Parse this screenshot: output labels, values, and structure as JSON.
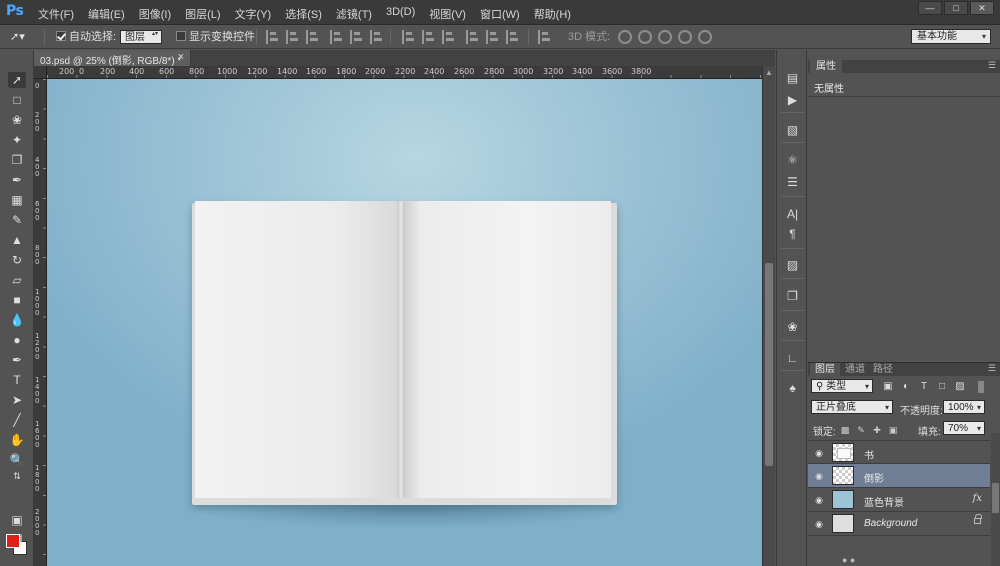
{
  "app": {
    "logo": "Ps",
    "menus": [
      "文件(F)",
      "编辑(E)",
      "图像(I)",
      "图层(L)",
      "文字(Y)",
      "选择(S)",
      "滤镜(T)",
      "3D(D)",
      "视图(V)",
      "窗口(W)",
      "帮助(H)"
    ],
    "window_controls": [
      "minimize",
      "restore",
      "close"
    ]
  },
  "options_bar": {
    "auto_select_label": "自动选择:",
    "auto_select_checked": true,
    "auto_select_value": "图层",
    "show_transform_label": "显示变换控件",
    "show_transform_checked": false,
    "mode_3d_label": "3D 模式:",
    "workspace": "基本功能"
  },
  "document": {
    "tab_title": "03.psd @ 25% (倒影, RGB/8*) *",
    "close_glyph": "×"
  },
  "rulers": {
    "horizontal": [
      "200",
      "0",
      "200",
      "400",
      "600",
      "800",
      "1000",
      "1200",
      "1400",
      "1600",
      "1800",
      "2000",
      "2200",
      "2400",
      "2600",
      "2800",
      "3000",
      "3200",
      "3400",
      "3600",
      "3800"
    ],
    "vertical": [
      "0",
      "200",
      "400",
      "600",
      "800",
      "1000",
      "1200",
      "1400",
      "1600",
      "1800",
      "2000"
    ]
  },
  "canvas": {
    "background_color": "#9ec4d6",
    "subject": "open blank book"
  },
  "colors": {
    "foreground": "#e31c1c",
    "background": "#ffffff",
    "selection": "#6f7e95"
  },
  "tools": [
    "move-tool",
    "marquee-tool",
    "lasso-tool",
    "magic-wand-tool",
    "eyedropper-tool",
    "healing-brush-tool",
    "brush-tool",
    "clone-stamp-tool",
    "history-brush-tool",
    "eraser-tool",
    "gradient-tool",
    "blur-tool",
    "dodge-tool",
    "pen-tool",
    "type-tool",
    "path-selection-tool",
    "line-tool",
    "hand-tool",
    "zoom-tool"
  ],
  "properties_panel": {
    "tab": "属性",
    "empty_text": "无属性"
  },
  "layers_panel": {
    "tabs": [
      "图层",
      "通道",
      "路径"
    ],
    "filter_kind": "类型",
    "blend_mode": "正片叠底",
    "opacity_label": "不透明度:",
    "opacity_value": "100%",
    "lock_label": "锁定:",
    "fill_label": "填充:",
    "fill_value": "70%",
    "layers": [
      {
        "name": "书",
        "selected": false,
        "has_fx": false,
        "locked": false
      },
      {
        "name": "倒影",
        "selected": true,
        "has_fx": false,
        "locked": false
      },
      {
        "name": "蓝色背景",
        "selected": false,
        "has_fx": true,
        "locked": false
      },
      {
        "name": "Background",
        "selected": false,
        "has_fx": false,
        "locked": true
      }
    ]
  }
}
